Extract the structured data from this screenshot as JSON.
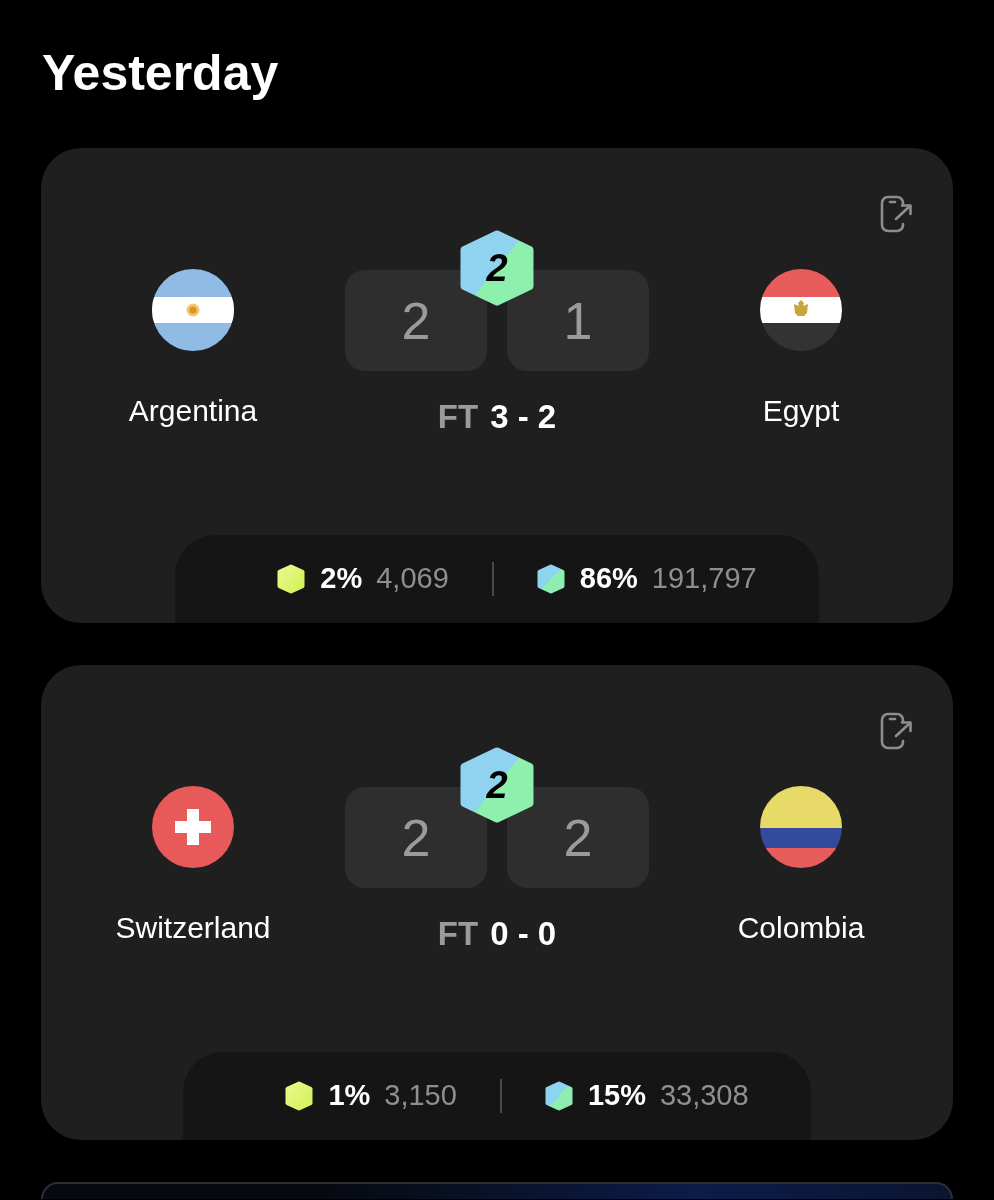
{
  "heading": "Yesterday",
  "matches": [
    {
      "home": {
        "name": "Argentina",
        "kind": "argentina"
      },
      "away": {
        "name": "Egypt",
        "kind": "egypt"
      },
      "badge": "2",
      "score_boxes": [
        "2",
        "1"
      ],
      "status": "FT",
      "score": "3 - 2",
      "votes": [
        {
          "kind": "lime",
          "percent": "2%",
          "count": "4,069"
        },
        {
          "kind": "aqua",
          "percent": "86%",
          "count": "191,797"
        }
      ]
    },
    {
      "home": {
        "name": "Switzerland",
        "kind": "switzerland"
      },
      "away": {
        "name": "Colombia",
        "kind": "colombia"
      },
      "badge": "2",
      "score_boxes": [
        "2",
        "2"
      ],
      "status": "FT",
      "score": "0 - 0",
      "votes": [
        {
          "kind": "lime",
          "percent": "1%",
          "count": "3,150"
        },
        {
          "kind": "aqua",
          "percent": "15%",
          "count": "33,308"
        }
      ]
    }
  ]
}
